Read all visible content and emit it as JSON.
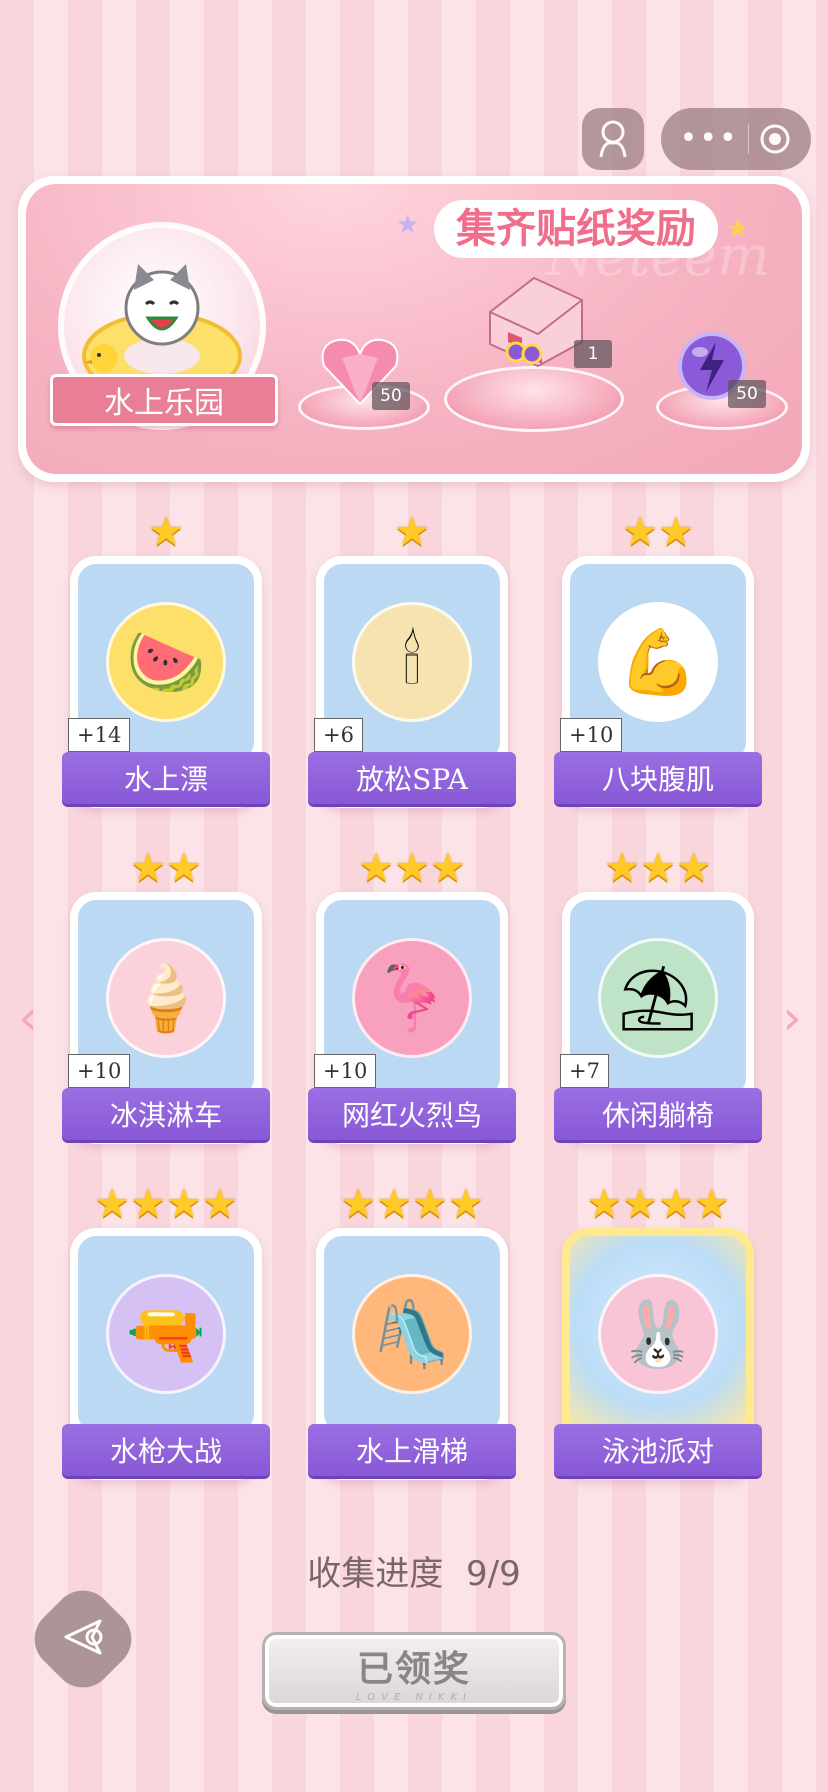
{
  "header": {
    "capsule_more_icon": "more-dots-icon",
    "capsule_close_icon": "target-circle-icon",
    "avatar_icon": "person-icon"
  },
  "banner": {
    "title": "集齐贴纸奖励",
    "watermark": "Neteem",
    "theme_label": "水上乐园",
    "rewards": [
      {
        "icon": "pink-heart-gem",
        "count": "50"
      },
      {
        "icon": "gift-box",
        "count": "1"
      },
      {
        "icon": "purple-lightning-orb",
        "count": "50"
      }
    ]
  },
  "stickers": [
    {
      "name": "水上漂",
      "stars": 1,
      "bonus": "+14",
      "art": "cat-on-float"
    },
    {
      "name": "放松SPA",
      "stars": 1,
      "bonus": "+6",
      "art": "aroma-diffuser"
    },
    {
      "name": "八块腹肌",
      "stars": 2,
      "bonus": "+10",
      "art": "muscle-cat"
    },
    {
      "name": "冰淇淋车",
      "stars": 2,
      "bonus": "+10",
      "art": "ice-cream-truck"
    },
    {
      "name": "网红火烈鸟",
      "stars": 3,
      "bonus": "+10",
      "art": "flamingo-float"
    },
    {
      "name": "休闲躺椅",
      "stars": 3,
      "bonus": "+7",
      "art": "beach-chair"
    },
    {
      "name": "水枪大战",
      "stars": 4,
      "bonus": "",
      "art": "water-gun-boy"
    },
    {
      "name": "水上滑梯",
      "stars": 4,
      "bonus": "",
      "art": "water-slide-girl"
    },
    {
      "name": "泳池派对",
      "stars": 4,
      "bonus": "",
      "art": "pool-party-bunny"
    }
  ],
  "progress": {
    "label": "收集进度",
    "value": "9/9"
  },
  "claim_button": {
    "label": "已领奖",
    "sub": "LOVE NIKKI"
  },
  "colors": {
    "ribbon": "#8858d6",
    "star": "#ffc928",
    "title": "#f06e8b",
    "bg_stripe_a": "#f8d6dc",
    "bg_stripe_b": "#fbe3e7"
  }
}
